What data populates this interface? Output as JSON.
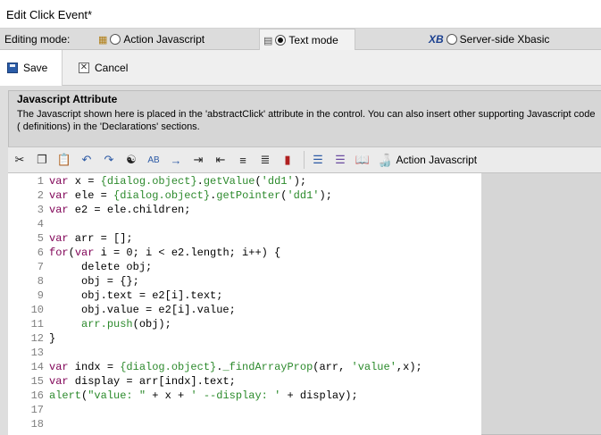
{
  "window": {
    "title": "Edit Click Event*"
  },
  "mode_bar": {
    "label": "Editing mode:",
    "modes": [
      {
        "label": "Action Javascript",
        "selected": false,
        "icon": "tree-icon"
      },
      {
        "label": "Text mode",
        "selected": true,
        "icon": "text-doc-icon"
      },
      {
        "label": "Server-side Xbasic",
        "selected": false,
        "icon": "xb-icon",
        "icon_text": "XB"
      }
    ]
  },
  "actions": {
    "save": "Save",
    "cancel": "Cancel"
  },
  "attribute": {
    "heading": "Javascript Attribute",
    "description": "The Javascript shown here is placed in the 'abstractClick' attribute in the control. You can also insert other supporting Javascript code ( definitions) in the 'Declarations' sections."
  },
  "toolbar": {
    "action_label": "Action Javascript",
    "icons": [
      "cut-icon",
      "copy-icon",
      "paste-icon",
      "undo-icon",
      "redo-icon",
      "find-icon",
      "replace-icon",
      "goto-icon",
      "indent-icon",
      "outdent-icon",
      "format-icon",
      "align-right-icon",
      "toggle-icon",
      "comment-icon",
      "uncomment-icon",
      "book-icon",
      "lamp-icon"
    ]
  },
  "editor": {
    "lines": [
      {
        "n": "1",
        "t": [
          [
            "kw",
            "var"
          ],
          [
            "p",
            " x = "
          ],
          [
            "gr",
            "{dialog.object}"
          ],
          [
            "p",
            "."
          ],
          [
            "gr",
            "getValue"
          ],
          [
            "p",
            "("
          ],
          [
            "st",
            "'dd1'"
          ],
          [
            "p",
            ");"
          ]
        ]
      },
      {
        "n": "2",
        "t": [
          [
            "kw",
            "var"
          ],
          [
            "p",
            " ele = "
          ],
          [
            "gr",
            "{dialog.object}"
          ],
          [
            "p",
            "."
          ],
          [
            "gr",
            "getPointer"
          ],
          [
            "p",
            "("
          ],
          [
            "st",
            "'dd1'"
          ],
          [
            "p",
            ");"
          ]
        ]
      },
      {
        "n": "3",
        "t": [
          [
            "kw",
            "var"
          ],
          [
            "p",
            " e2 = ele.children;"
          ]
        ]
      },
      {
        "n": "4",
        "t": []
      },
      {
        "n": "5",
        "t": [
          [
            "kw",
            "var"
          ],
          [
            "p",
            " arr = [];"
          ]
        ]
      },
      {
        "n": "6",
        "t": [
          [
            "kw",
            "for"
          ],
          [
            "p",
            "("
          ],
          [
            "kw",
            "var"
          ],
          [
            "p",
            " i = 0; i < e2.length; i++) {"
          ]
        ]
      },
      {
        "n": "7",
        "t": [
          [
            "p",
            "     delete obj;"
          ]
        ]
      },
      {
        "n": "8",
        "t": [
          [
            "p",
            "     obj = {};"
          ]
        ]
      },
      {
        "n": "9",
        "t": [
          [
            "p",
            "     obj.text = e2[i].text;"
          ]
        ]
      },
      {
        "n": "10",
        "t": [
          [
            "p",
            "     obj.value = e2[i].value;"
          ]
        ]
      },
      {
        "n": "11",
        "t": [
          [
            "p",
            "     "
          ],
          [
            "gr",
            "arr.push"
          ],
          [
            "p",
            "(obj);"
          ]
        ]
      },
      {
        "n": "12",
        "t": [
          [
            "p",
            "}"
          ]
        ]
      },
      {
        "n": "13",
        "t": []
      },
      {
        "n": "14",
        "t": [
          [
            "kw",
            "var"
          ],
          [
            "p",
            " indx = "
          ],
          [
            "gr",
            "{dialog.object}"
          ],
          [
            "p",
            "."
          ],
          [
            "gr",
            "_findArrayProp"
          ],
          [
            "p",
            "(arr, "
          ],
          [
            "st",
            "'value'"
          ],
          [
            "p",
            ",x);"
          ]
        ]
      },
      {
        "n": "15",
        "t": [
          [
            "kw",
            "var"
          ],
          [
            "p",
            " display = arr[indx].text;"
          ]
        ]
      },
      {
        "n": "16",
        "t": [
          [
            "gr",
            "alert"
          ],
          [
            "p",
            "("
          ],
          [
            "st",
            "\"value: \""
          ],
          [
            "p",
            " + x + "
          ],
          [
            "st",
            "' --display: '"
          ],
          [
            "p",
            " + display);"
          ]
        ]
      },
      {
        "n": "17",
        "t": []
      },
      {
        "n": "18",
        "t": []
      }
    ]
  }
}
